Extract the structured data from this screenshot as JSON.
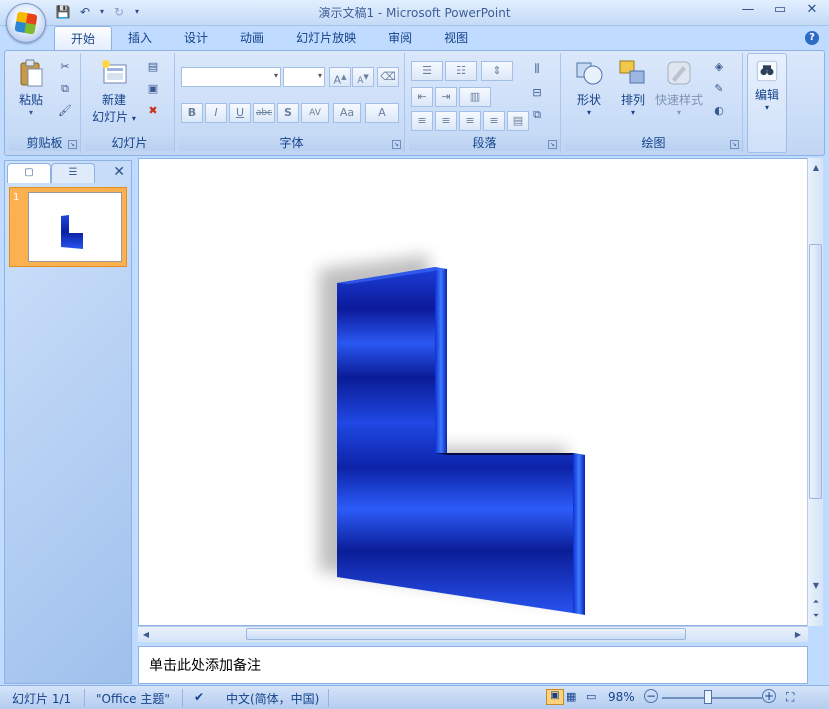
{
  "window": {
    "title": "演示文稿1 - Microsoft PowerPoint"
  },
  "tabs": [
    "开始",
    "插入",
    "设计",
    "动画",
    "幻灯片放映",
    "审阅",
    "视图"
  ],
  "ribbon": {
    "clipboard": {
      "label": "剪贴板",
      "paste": "粘贴"
    },
    "slides": {
      "label": "幻灯片",
      "new_slide_line1": "新建",
      "new_slide_line2": "幻灯片"
    },
    "font": {
      "label": "字体",
      "bold": "B",
      "italic": "I",
      "underline": "U",
      "strikethrough": "abc",
      "shadow": "S",
      "spacing": "AV",
      "case": "Aa",
      "color": "A",
      "grow": "A",
      "shrink": "A"
    },
    "paragraph": {
      "label": "段落"
    },
    "drawing": {
      "label": "绘图",
      "shapes": "形状",
      "arrange": "排列",
      "quick_styles": "快速样式"
    },
    "editing": {
      "label": "编辑"
    }
  },
  "slide_pane": {
    "slide_number": "1"
  },
  "notes": {
    "placeholder": "单击此处添加备注"
  },
  "status": {
    "slide": "幻灯片 1/1",
    "theme": "\"Office 主题\"",
    "language": "中文(简体，中国)",
    "zoom": "98%"
  },
  "colors": {
    "accent": "#15428b",
    "shape_blue": "#1a3fd6"
  }
}
